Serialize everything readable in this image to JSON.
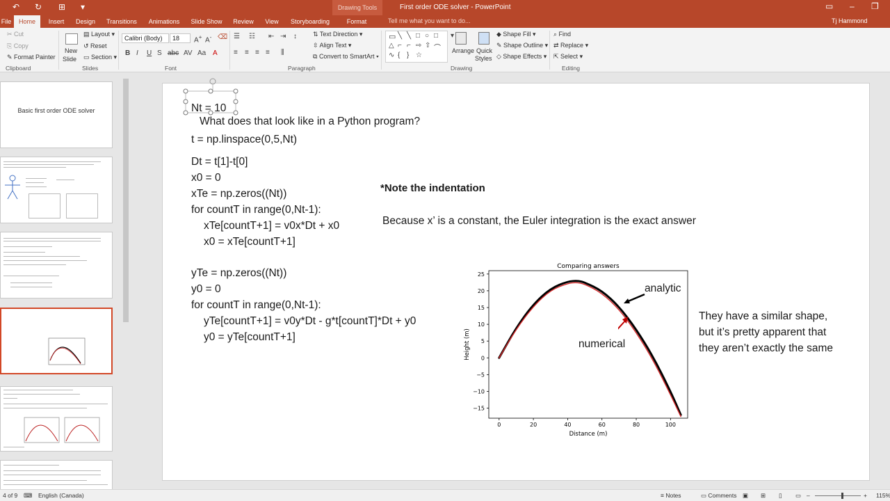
{
  "window": {
    "drawing_tools": "Drawing Tools",
    "doc_title": "First order ODE solver - PowerPoint",
    "user": "Tj Hammond",
    "tell_me": "Tell me what you want to do..."
  },
  "tabs": [
    "File",
    "Home",
    "Insert",
    "Design",
    "Transitions",
    "Animations",
    "Slide Show",
    "Review",
    "View",
    "Storyboarding",
    "Format"
  ],
  "ribbon": {
    "clipboard": {
      "label": "Clipboard",
      "cut": "Cut",
      "copy": "Copy",
      "format_painter": "Format Painter"
    },
    "slides": {
      "label": "Slides",
      "new_slide": "New",
      "new_slide2": "Slide",
      "layout": "Layout",
      "reset": "Reset",
      "section": "Section"
    },
    "font": {
      "label": "Font",
      "name": "Calibri (Body)",
      "size": "18"
    },
    "paragraph": {
      "label": "Paragraph",
      "text_direction": "Text Direction",
      "align_text": "Align Text",
      "smartart": "Convert to SmartArt"
    },
    "drawing": {
      "label": "Drawing",
      "arrange": "Arrange",
      "quick_styles": "Quick",
      "quick_styles2": "Styles",
      "shape_fill": "Shape Fill",
      "shape_outline": "Shape Outline",
      "shape_effects": "Shape Effects"
    },
    "editing": {
      "label": "Editing",
      "find": "Find",
      "replace": "Replace",
      "select": "Select"
    }
  },
  "thumbnails": {
    "first_title": "Basic first order ODE solver"
  },
  "slide": {
    "nt_line": "Nt = 10",
    "heading": "What does that look like in a Python program?",
    "code_block1": [
      "t = np.linspace(0,5,Nt)",
      "Dt = t[1]-t[0]",
      "x0 = 0",
      "xTe = np.zeros((Nt))",
      "for countT in range(0,Nt-1):",
      "xTe[countT+1] = v0x*Dt + x0",
      "x0 = xTe[countT+1]"
    ],
    "code_block2": [
      "yTe = np.zeros((Nt))",
      "y0 = 0",
      "for countT in range(0,Nt-1):",
      "yTe[countT+1] = v0y*Dt - g*t[countT]*Dt  + y0",
      "y0 = yTe[countT+1]"
    ],
    "note_indent": "*Note the indentation",
    "note_euler": "Because x’ is a constant, the Euler integration is the exact answer",
    "label_analytic": "analytic",
    "label_numerical": "numerical",
    "comment": [
      "They have a similar shape,",
      "but it’s pretty apparent that",
      "they aren’t exactly the same"
    ]
  },
  "chart_data": {
    "type": "line",
    "title": "Comparing answers",
    "xlabel": "Distance (m)",
    "ylabel": "Height (m)",
    "xlim": [
      -6,
      110
    ],
    "ylim": [
      -18,
      26
    ],
    "xticks": [
      0,
      20,
      40,
      60,
      80,
      100
    ],
    "yticks": [
      -15,
      -10,
      -5,
      0,
      5,
      10,
      15,
      20,
      25
    ],
    "series": [
      {
        "name": "analytic",
        "color": "#000000",
        "x": [
          0,
          10,
          20,
          30,
          40,
          46,
          50,
          60,
          70,
          80,
          90,
          100,
          106
        ],
        "y": [
          0,
          9.0,
          16.0,
          20.7,
          22.8,
          23.0,
          22.5,
          20.0,
          15.3,
          8.5,
          0.2,
          -10.0,
          -17.0
        ]
      },
      {
        "name": "numerical",
        "color": "#d62728",
        "x": [
          0,
          10,
          20,
          30,
          40,
          45,
          50,
          60,
          70,
          80,
          90,
          100,
          106
        ],
        "y": [
          0,
          8.6,
          15.4,
          20.2,
          22.2,
          22.5,
          22.0,
          19.3,
          14.5,
          7.6,
          -0.8,
          -11.0,
          -17.5
        ]
      }
    ]
  },
  "status": {
    "slide_of": "4 of 9",
    "language": "English (Canada)",
    "notes": "Notes",
    "comments": "Comments",
    "zoom": "115%"
  },
  "colors": {
    "accent": "#b7472a",
    "selected_thumb": "#d24726"
  }
}
